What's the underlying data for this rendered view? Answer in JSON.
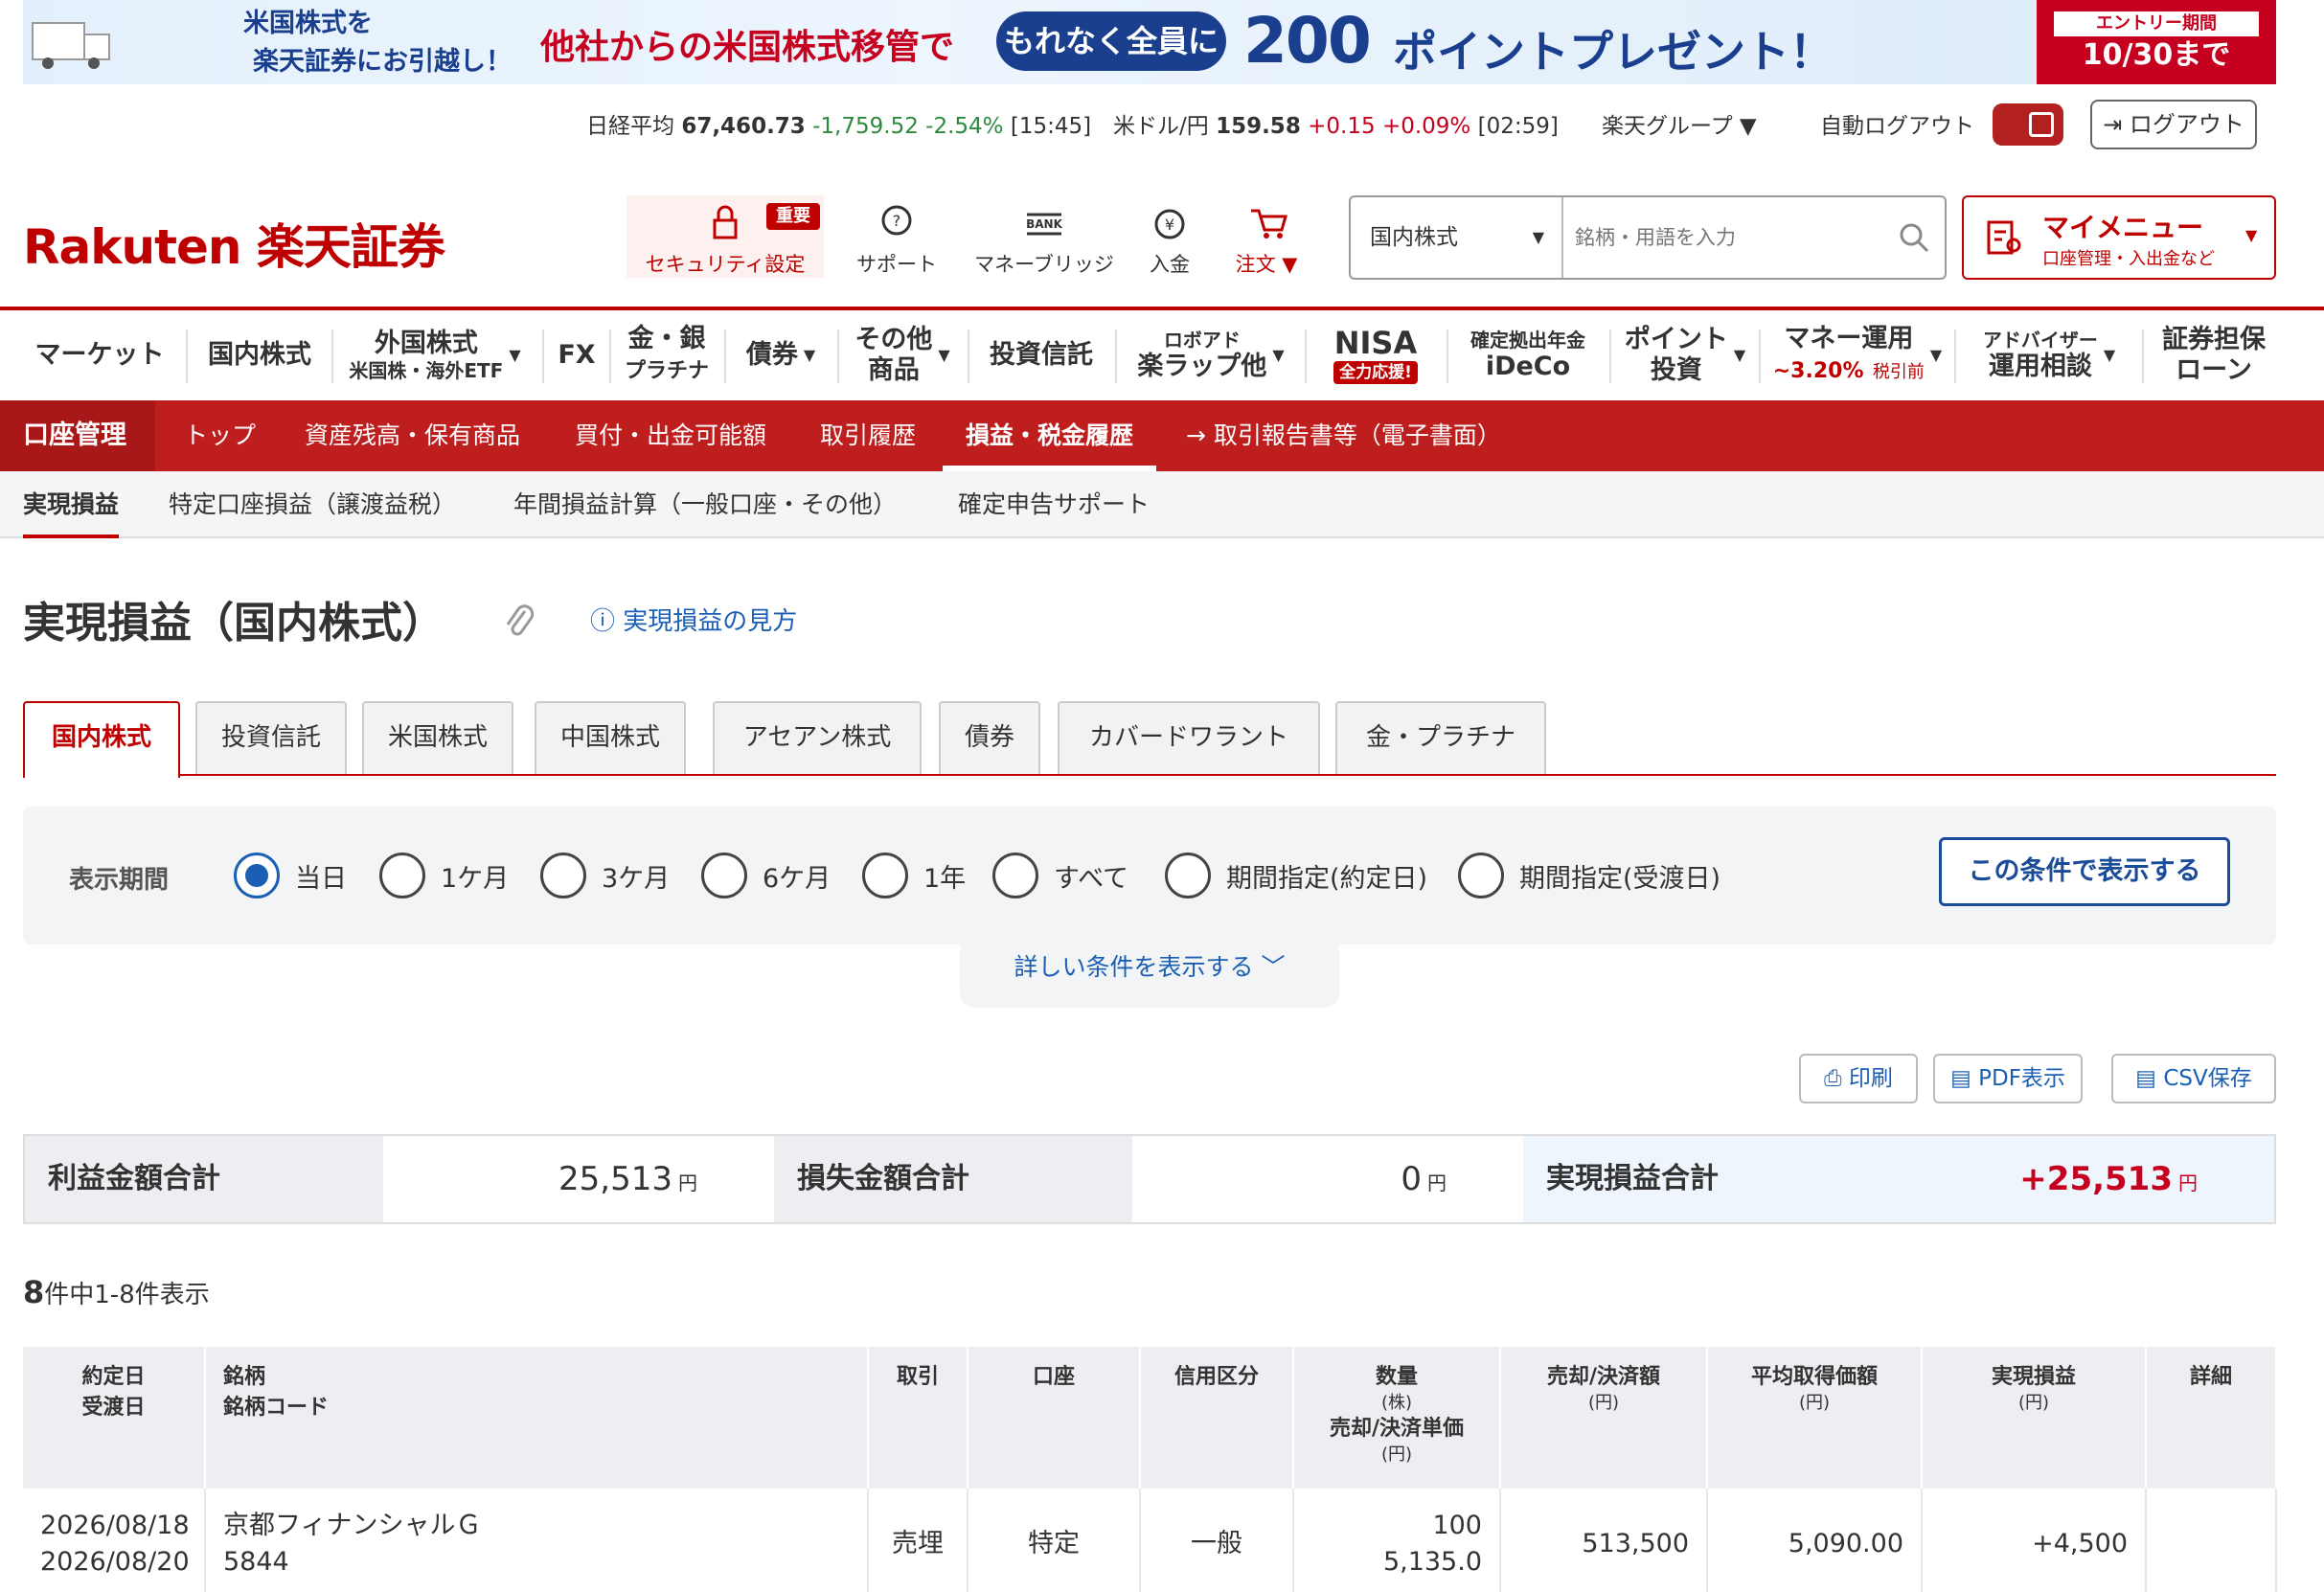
{
  "banner": {
    "line1": "米国株式を",
    "line2": "楽天証券にお引越し！",
    "transfer": "他社からの米国株式移管で",
    "pill": "もれなく全員に",
    "points": "200",
    "present": "ポイントプレゼント！",
    "entry_label": "エントリー期間",
    "entry_date": "10/30まで"
  },
  "ticker": {
    "nikkei_label": "日経平均",
    "nikkei_value": "67,460.73",
    "nikkei_change": "-1,759.52",
    "nikkei_pct": "-2.54%",
    "nikkei_time": "[15:45]",
    "usd_label": "米ドル/円",
    "usd_value": "159.58",
    "usd_change": "+0.15",
    "usd_pct": "+0.09%",
    "usd_time": "[02:59]",
    "group": "楽天グループ ▼",
    "auto_logout": "自動ログアウト",
    "logout": "ログアウト"
  },
  "header": {
    "logo": "Rakuten 楽天証券",
    "security": "セキュリティ設定",
    "important": "重要",
    "support": "サポート",
    "bridge": "マネーブリッジ",
    "deposit": "入金",
    "order": "注文 ▼",
    "search_category": "国内株式",
    "search_placeholder": "銘柄・用語を入力",
    "mymenu": "マイメニュー",
    "mymenu_sub": "口座管理・入出金など"
  },
  "mainnav": {
    "market": "マーケット",
    "domestic": "国内株式",
    "foreign": "外国株式",
    "foreign_sub": "米国株・海外ETF",
    "fx": "FX",
    "gold1": "金・銀",
    "gold2": "プラチナ",
    "bond": "債券",
    "other1": "その他",
    "other2": "商品",
    "fund": "投資信託",
    "robo1": "ロボアド",
    "robo2": "楽ラップ他",
    "nisa": "NISA",
    "nisa_sub": "全力応援!",
    "ideco1": "確定拠出年金",
    "ideco2": "iDeCo",
    "point1": "ポイント",
    "point2": "投資",
    "money1": "マネー運用",
    "money2": "~3.20%",
    "money3": "税引前",
    "adv1": "アドバイザー",
    "adv2": "運用相談",
    "loan1": "証券担保",
    "loan2": "ローン"
  },
  "redbar": {
    "head": "口座管理",
    "items": [
      "トップ",
      "資産残高・保有商品",
      "買付・出金可能額",
      "取引履歴",
      "損益・税金履歴",
      "→ 取引報告書等（電子書面）"
    ]
  },
  "subnav": [
    "実現損益",
    "特定口座損益（譲渡益税）",
    "年間損益計算（一般口座・その他）",
    "確定申告サポート"
  ],
  "page": {
    "title": "実現損益（国内株式）",
    "help": "実現損益の見方"
  },
  "tabs": [
    "国内株式",
    "投資信託",
    "米国株式",
    "中国株式",
    "アセアン株式",
    "債券",
    "カバードワラント",
    "金・プラチナ"
  ],
  "conditions": {
    "label": "表示期間",
    "options": [
      "当日",
      "1ケ月",
      "3ケ月",
      "6ケ月",
      "1年",
      "すべて",
      "期間指定(約定日)",
      "期間指定(受渡日)"
    ],
    "selected": "当日",
    "submit": "この条件で表示する",
    "more": "詳しい条件を表示する ﹀"
  },
  "output": {
    "print": "印刷",
    "pdf": "PDF表示",
    "csv": "CSV保存"
  },
  "summary": {
    "profit_label": "利益金額合計",
    "profit_value": "25,513",
    "loss_label": "損失金額合計",
    "loss_value": "0",
    "total_label": "実現損益合計",
    "total_value": "+25,513",
    "unit": "円"
  },
  "count": {
    "num": "8",
    "text": "件中1-8件表示"
  },
  "table": {
    "headers": {
      "date1": "約定日",
      "date2": "受渡日",
      "name1": "銘柄",
      "name2": "銘柄コード",
      "trade": "取引",
      "account": "口座",
      "credit": "信用区分",
      "qty": "数量",
      "qty_unit": "(株)",
      "price": "売却/決済単価",
      "price_unit": "(円)",
      "amount": "売却/決済額",
      "amount_unit": "(円)",
      "avg": "平均取得価額",
      "avg_unit": "(円)",
      "pl": "実現損益",
      "pl_unit": "(円)",
      "detail": "詳細"
    },
    "rows": [
      {
        "date": "2026/08/18",
        "settle": "2026/08/20",
        "name": "京都フィナンシャルＧ",
        "code": "5844",
        "trade": "売埋",
        "account": "特定",
        "credit": "一般",
        "qty": "100",
        "price": "5,135.0",
        "amount": "513,500",
        "avg": "5,090.00",
        "pl": "+4,500"
      }
    ]
  }
}
